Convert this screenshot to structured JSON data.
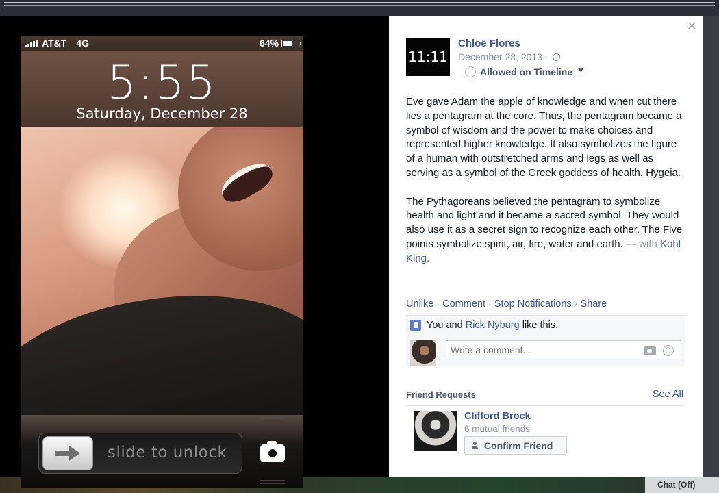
{
  "phone": {
    "status": {
      "carrier": "AT&T",
      "network": "4G",
      "battery_percent": "64%",
      "battery_level": 0.64
    },
    "lock_time": "5:55",
    "lock_date": "Saturday, December 28",
    "slide_text": "slide to unlock"
  },
  "post": {
    "thumbnail_text": "11:11",
    "author": "Chloë Flores",
    "date": "December 28, 2013 ·",
    "timeline_label": "Allowed on Timeline",
    "paragraph1": "Eve gave Adam the apple of knowledge and when cut there lies a pentagram at the core. Thus, the pentagram became a symbol of wisdom and the power to make choices and represented higher knowledge. It also symbolizes the figure of a human with outstretched arms and legs as well as serving as a symbol of the Greek goddess of health, Hygeia.",
    "paragraph2": "The Pythagoreans believed the pentagram to symbolize health and light and it became a sacred symbol. They would also use it as a secret sign to recognize each other. The Five points symbolize spirit, air, fire, water and earth.",
    "with_prefix": "— with",
    "with_name": "Kohl King."
  },
  "actions": {
    "unlike": "Unlike",
    "comment": "Comment",
    "stop_notifications": "Stop Notifications",
    "share": "Share",
    "separator": "·"
  },
  "likes": {
    "prefix": "You and",
    "name": "Rick Nyburg",
    "suffix": "like this."
  },
  "comment_box": {
    "placeholder": "Write a comment..."
  },
  "friend_requests": {
    "title": "Friend Requests",
    "see_all": "See All",
    "name": "Clifford Brock",
    "mutual": "6 mutual friends",
    "confirm": "Confirm Friend"
  },
  "chat": {
    "label": "Chat (Off)"
  },
  "colors": {
    "link": "#3b5998",
    "panel_bg": "#ffffff",
    "overlay_bg": "#000000"
  }
}
